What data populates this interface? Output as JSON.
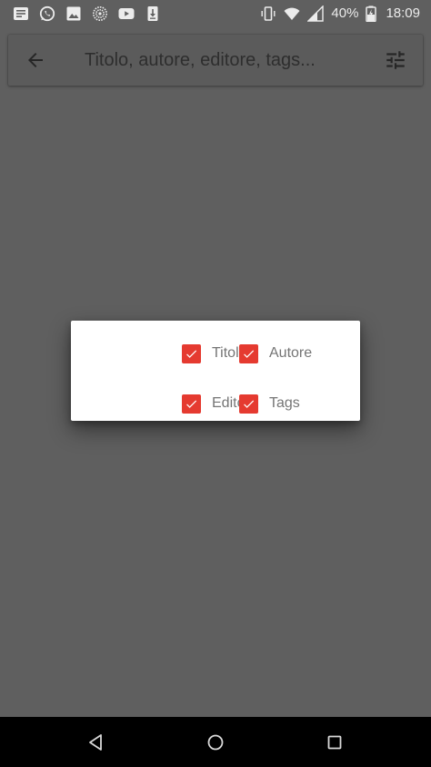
{
  "status_bar": {
    "icons": [
      "news-icon",
      "whatsapp-icon",
      "gallery-icon",
      "sync-icon",
      "youtube-icon",
      "download-icon"
    ],
    "right_icons": [
      "vibrate-icon",
      "wifi-icon",
      "signal-icon"
    ],
    "battery_percent": "40%",
    "time": "18:09"
  },
  "search": {
    "placeholder": "Titolo, autore, editore, tags...",
    "value": "",
    "back_icon": "arrow-left-icon",
    "filter_icon": "tune-icon"
  },
  "dialog": {
    "options": [
      {
        "label": "Titolo",
        "checked": true
      },
      {
        "label": "Autore",
        "checked": true
      },
      {
        "label": "Editore",
        "checked": true
      },
      {
        "label": "Tags",
        "checked": true
      }
    ],
    "accent_color": "#e53a30"
  },
  "nav_bar": {
    "back_icon": "triangle-back-icon",
    "home_icon": "circle-home-icon",
    "recents_icon": "square-recents-icon"
  },
  "colors": {
    "scrim": "#5f5f5f",
    "dialog_bg": "#ffffff",
    "checkbox": "#e53a30",
    "nav_bar": "#000000"
  }
}
